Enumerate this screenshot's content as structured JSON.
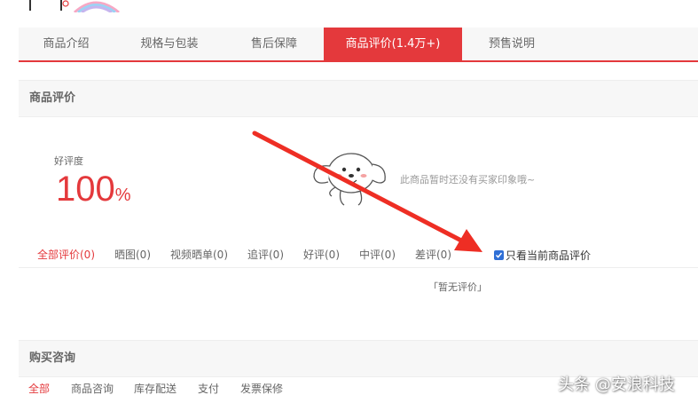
{
  "tabs": [
    {
      "label": "商品介绍"
    },
    {
      "label": "规格与包装"
    },
    {
      "label": "售后保障"
    },
    {
      "label": "商品评价(1.4万+)"
    },
    {
      "label": "预售说明"
    }
  ],
  "colors": {
    "accent": "#e4393c",
    "checkbox": "#2f6fd6"
  },
  "reviews": {
    "section_title": "商品评价",
    "rating_label": "好评度",
    "rating_value": "100",
    "rating_unit": "%",
    "empty_tags_text": "此商品暂时还没有买家印象哦~",
    "filters": [
      "全部评价(0)",
      "晒图(0)",
      "视频晒单(0)",
      "追评(0)",
      "好评(0)",
      "中评(0)",
      "差评(0)"
    ],
    "only_current_label": "只看当前商品评价",
    "only_current_checked": true,
    "no_reviews_text": "「暂无评价」"
  },
  "consult": {
    "section_title": "购买咨询",
    "tabs": [
      "全部",
      "商品咨询",
      "库存配送",
      "支付",
      "发票保修"
    ]
  },
  "watermark": "头条 @安浪科技",
  "icons": {
    "mascot": "jd-dog-mascot-icon",
    "arrow": "red-arrow-annotation",
    "checkbox": "check-icon"
  }
}
